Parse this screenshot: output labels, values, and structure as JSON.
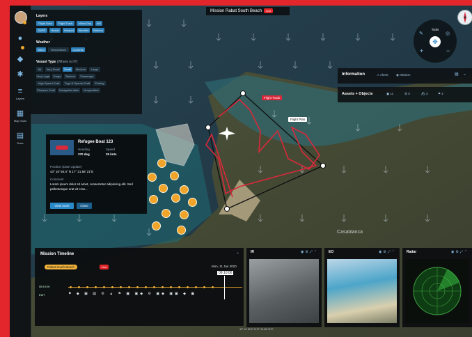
{
  "colors": {
    "accent_red": "#e2262b",
    "accent_blue": "#2c7fb8",
    "marker_orange": "#f0a52a",
    "flight_track": "#d9293a",
    "flight_plan": "#111111"
  },
  "header": {
    "title": "Mission Rabat South Beach",
    "live": "Live"
  },
  "sidebar": {
    "items": [
      {
        "label": "Layers",
        "icon": "layers-icon"
      },
      {
        "label": "Map Tools",
        "icon": "map-tools-icon"
      },
      {
        "label": "Docs",
        "icon": "docs-icon"
      }
    ]
  },
  "layers_panel": {
    "title": "Layers",
    "layer_chips": [
      "Flight Data",
      "Flight Track",
      "Video Dsp",
      "AIS",
      "SARE",
      "Heads",
      "Hotspot",
      "Weather",
      "Buttons"
    ],
    "weather_title": "Weather",
    "weather_chips": [
      "Wind",
      "Temperature",
      "Currents"
    ],
    "vessel_title": "Vessel Type",
    "vessel_hint": "(Where is it?)",
    "vessel_chips": [
      "All",
      "Very Small",
      "Small",
      "Medium",
      "Large",
      "Very Large",
      "Cargo",
      "Tankers",
      "Passenger",
      "High Speed Craft",
      "Tugs & Special Craft",
      "Fishing",
      "Pleasure Craft",
      "Navigation Aids",
      "Unspecified"
    ]
  },
  "tools": {
    "title": "Tools"
  },
  "info_panel": {
    "title": "Information",
    "tab_alerts": "Alerts",
    "tab_mission": "Mission",
    "assets_title": "Assets + Objects",
    "count1": "11",
    "count2": "0",
    "count3": "3",
    "count4": "2"
  },
  "map_labels": {
    "flight_track": "Flight Track",
    "flight_plan": "Flight Plan",
    "place": "Casablanca"
  },
  "popup": {
    "name": "Refugee Boat 123",
    "heading_label": "Heading",
    "heading_value": "370 deg",
    "speed_label": "Speed",
    "speed_value": "25 knts",
    "position_label": "Position (Date Update)",
    "position_value": "43° 10' 50.0\" N 17° 21.56' 21\"E",
    "comment_label": "Comment",
    "comment_text": "Lorem ipsum dolor sit amet, consectetur adipiscing elit. Sed pellentesque erat vit cras...",
    "btn_primary": "View more",
    "btn_secondary": "Close"
  },
  "timeline": {
    "title": "Mission Timeline",
    "mission_chip": "Rabat South Beach",
    "live": "Live",
    "date": "Mon, 11 Jan 2020",
    "time": "09:10:00",
    "row1_label": "08:10:00",
    "row2_label": "EWT"
  },
  "cameras": [
    {
      "title": "IR"
    },
    {
      "title": "EO"
    },
    {
      "title": "Radar"
    }
  ],
  "status": {
    "coords": "43° 10' 50.0\" N 17° 21.56' 21\"E"
  }
}
